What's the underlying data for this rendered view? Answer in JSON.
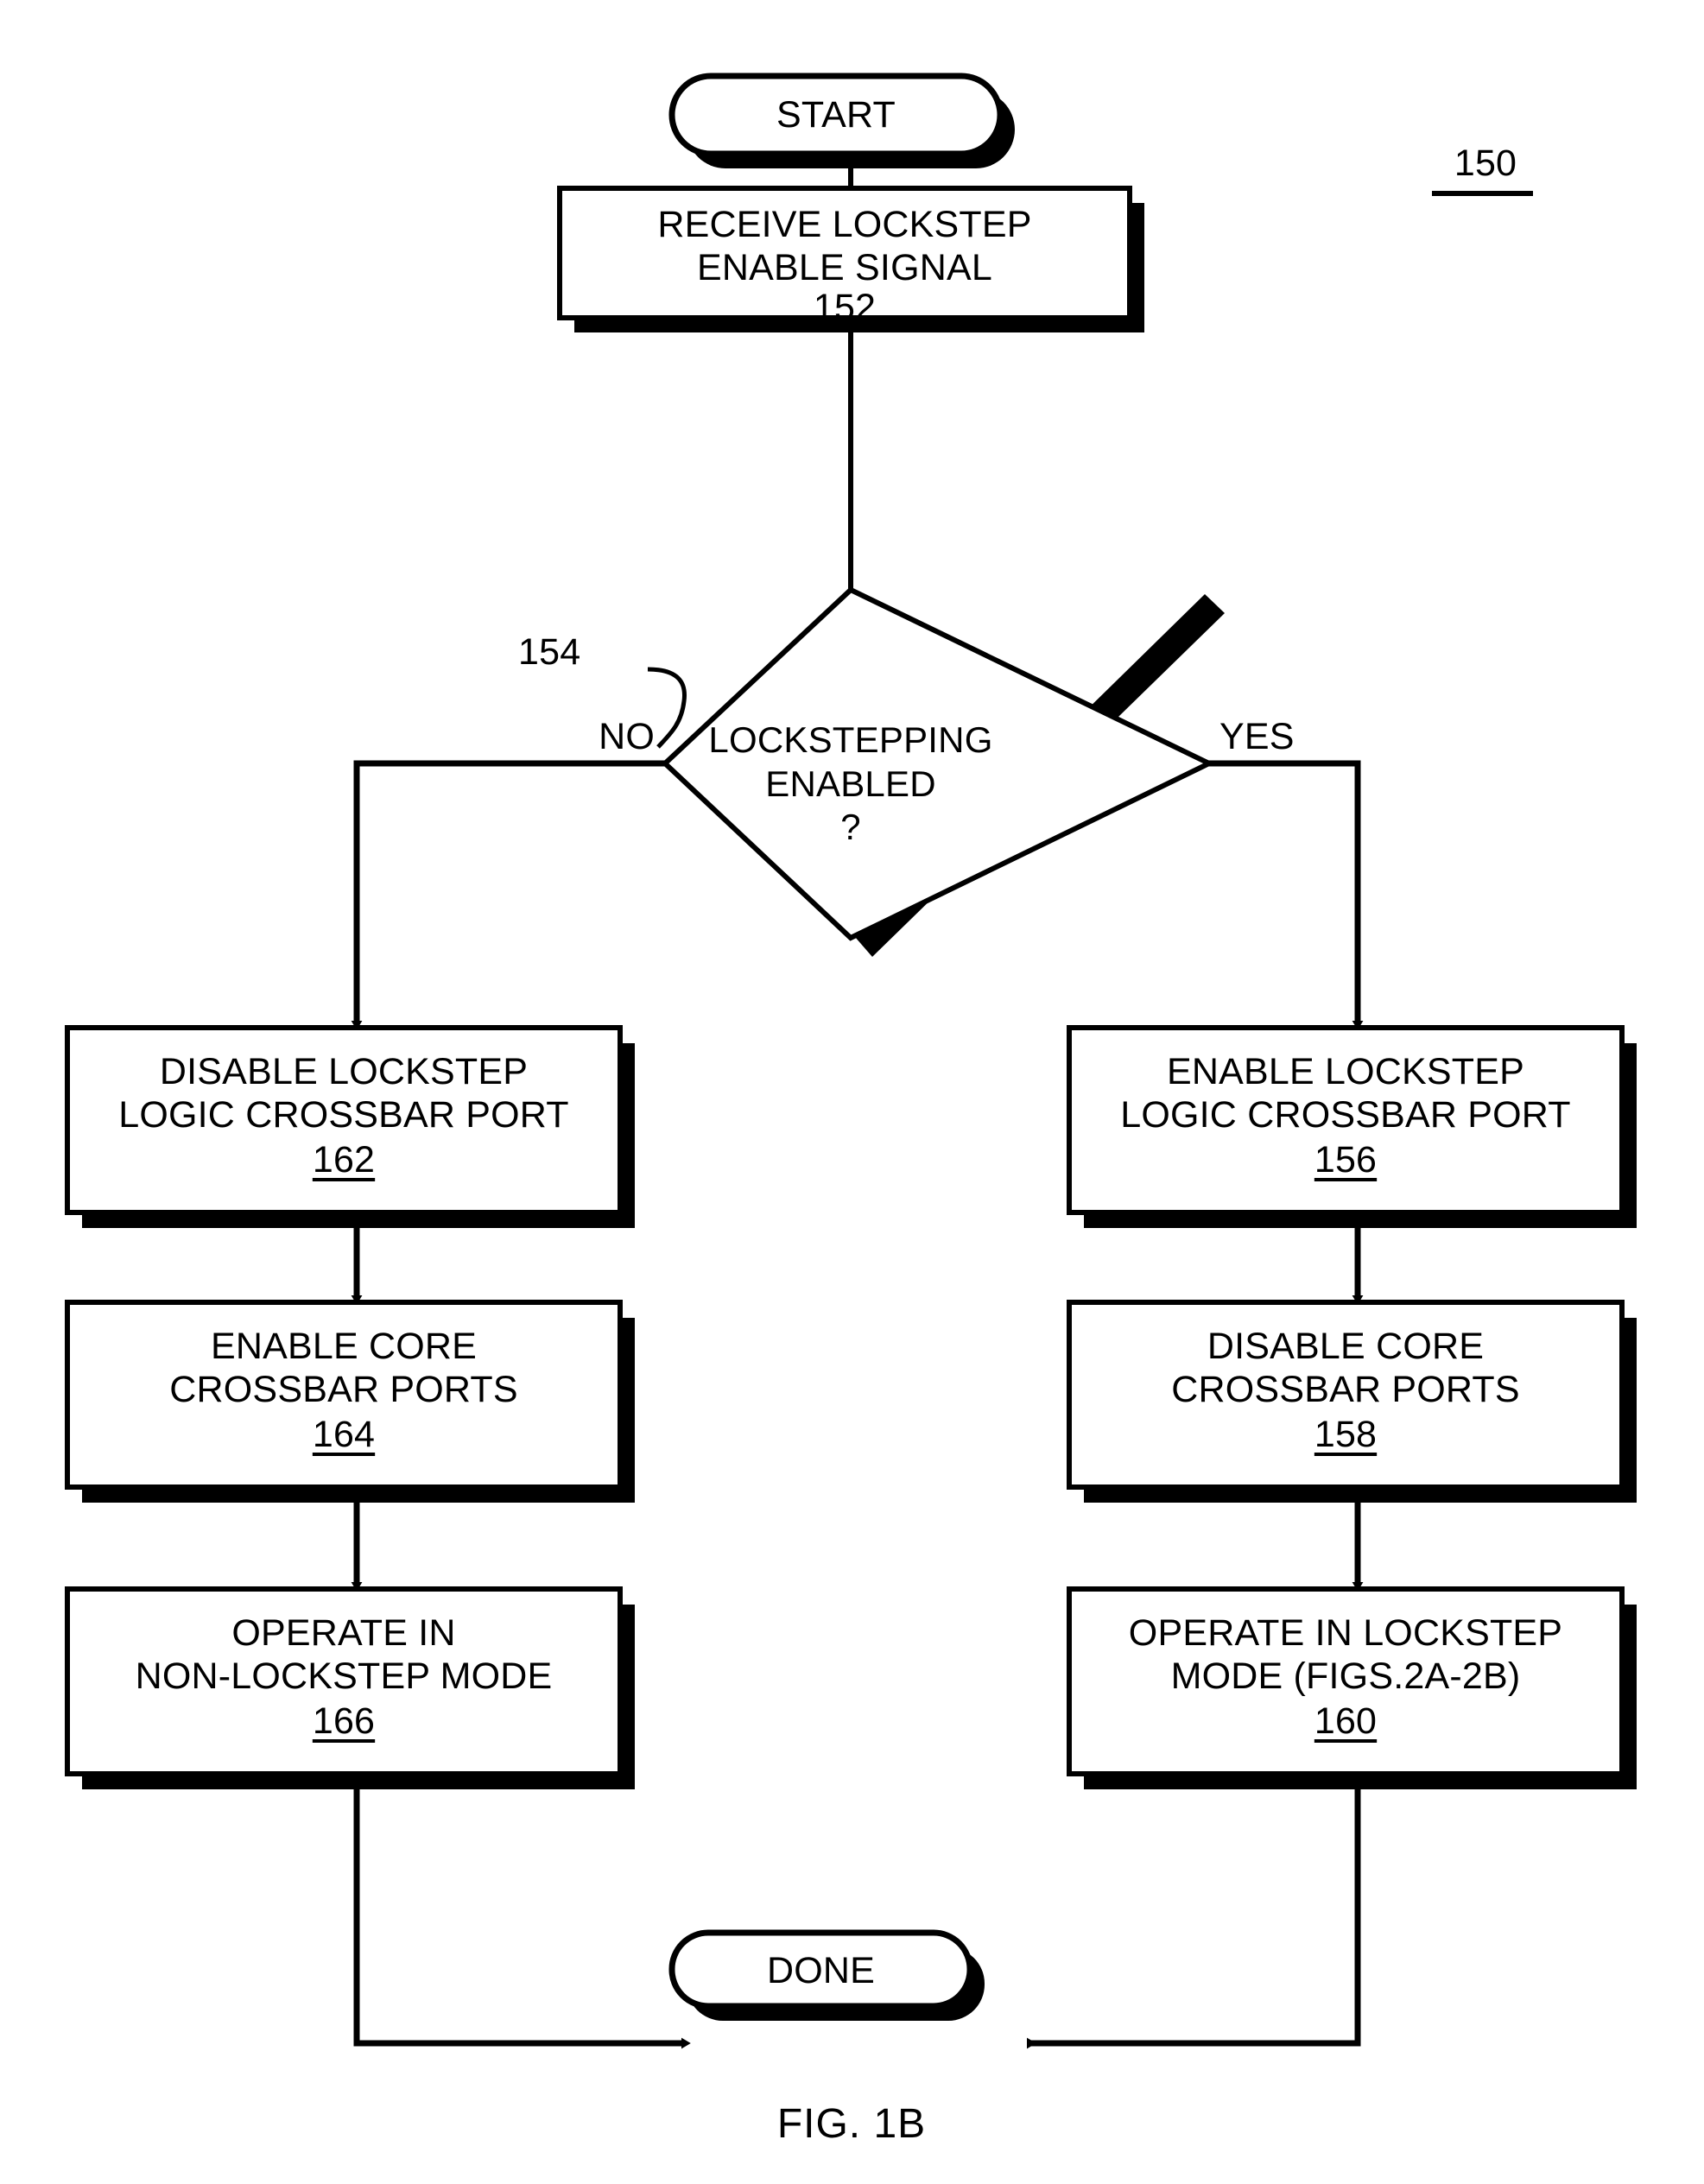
{
  "figure": {
    "caption": "FIG. 1B",
    "reference_numeral": "150"
  },
  "nodes": {
    "start": {
      "id": "start",
      "shape": "terminator",
      "label": "START"
    },
    "receive": {
      "id": "receive",
      "shape": "process",
      "line1": "RECEIVE LOCKSTEP",
      "line2": "ENABLE SIGNAL",
      "ref": "152"
    },
    "decision": {
      "id": "decision",
      "shape": "decision",
      "line1": "LOCKSTEPPING",
      "line2": "ENABLED",
      "line3": "?",
      "ref": "154",
      "branch_no": "NO",
      "branch_yes": "YES"
    },
    "disable_lockstep_logic": {
      "id": "disable_lockstep_logic",
      "shape": "process",
      "line1": "DISABLE LOCKSTEP",
      "line2": "LOGIC CROSSBAR PORT",
      "ref": "162"
    },
    "enable_core_ports": {
      "id": "enable_core_ports",
      "shape": "process",
      "line1": "ENABLE CORE",
      "line2": "CROSSBAR PORTS",
      "ref": "164"
    },
    "operate_non_lockstep": {
      "id": "operate_non_lockstep",
      "shape": "process",
      "line1": "OPERATE IN",
      "line2": "NON-LOCKSTEP MODE",
      "ref": "166"
    },
    "enable_lockstep_logic": {
      "id": "enable_lockstep_logic",
      "shape": "process",
      "line1": "ENABLE LOCKSTEP",
      "line2": "LOGIC CROSSBAR PORT",
      "ref": "156"
    },
    "disable_core_ports": {
      "id": "disable_core_ports",
      "shape": "process",
      "line1": "DISABLE CORE",
      "line2": "CROSSBAR PORTS",
      "ref": "158"
    },
    "operate_lockstep": {
      "id": "operate_lockstep",
      "shape": "process",
      "line1": "OPERATE IN LOCKSTEP",
      "line2": "MODE (FIGS.2A-2B)",
      "ref": "160"
    },
    "done": {
      "id": "done",
      "shape": "terminator",
      "label": "DONE"
    }
  },
  "colors": {
    "ink": "#000000",
    "paper": "#ffffff",
    "shadow": "#000000"
  },
  "chart_data": {
    "type": "diagram",
    "title": "FIG. 1B",
    "flow": [
      {
        "from": "START",
        "to": "RECEIVE LOCKSTEP ENABLE SIGNAL 152",
        "label": ""
      },
      {
        "from": "RECEIVE LOCKSTEP ENABLE SIGNAL 152",
        "to": "LOCKSTEPPING ENABLED ? 154",
        "label": ""
      },
      {
        "from": "LOCKSTEPPING ENABLED ? 154",
        "to": "DISABLE LOCKSTEP LOGIC CROSSBAR PORT 162",
        "label": "NO"
      },
      {
        "from": "LOCKSTEPPING ENABLED ? 154",
        "to": "ENABLE LOCKSTEP LOGIC CROSSBAR PORT 156",
        "label": "YES"
      },
      {
        "from": "DISABLE LOCKSTEP LOGIC CROSSBAR PORT 162",
        "to": "ENABLE CORE CROSSBAR PORTS 164",
        "label": ""
      },
      {
        "from": "ENABLE CORE CROSSBAR PORTS 164",
        "to": "OPERATE IN NON-LOCKSTEP MODE 166",
        "label": ""
      },
      {
        "from": "OPERATE IN NON-LOCKSTEP MODE 166",
        "to": "DONE",
        "label": ""
      },
      {
        "from": "ENABLE LOCKSTEP LOGIC CROSSBAR PORT 156",
        "to": "DISABLE CORE CROSSBAR PORTS 158",
        "label": ""
      },
      {
        "from": "DISABLE CORE CROSSBAR PORTS 158",
        "to": "OPERATE IN LOCKSTEP MODE (FIGS.2A-2B) 160",
        "label": ""
      },
      {
        "from": "OPERATE IN LOCKSTEP MODE (FIGS.2A-2B) 160",
        "to": "DONE",
        "label": ""
      }
    ]
  }
}
